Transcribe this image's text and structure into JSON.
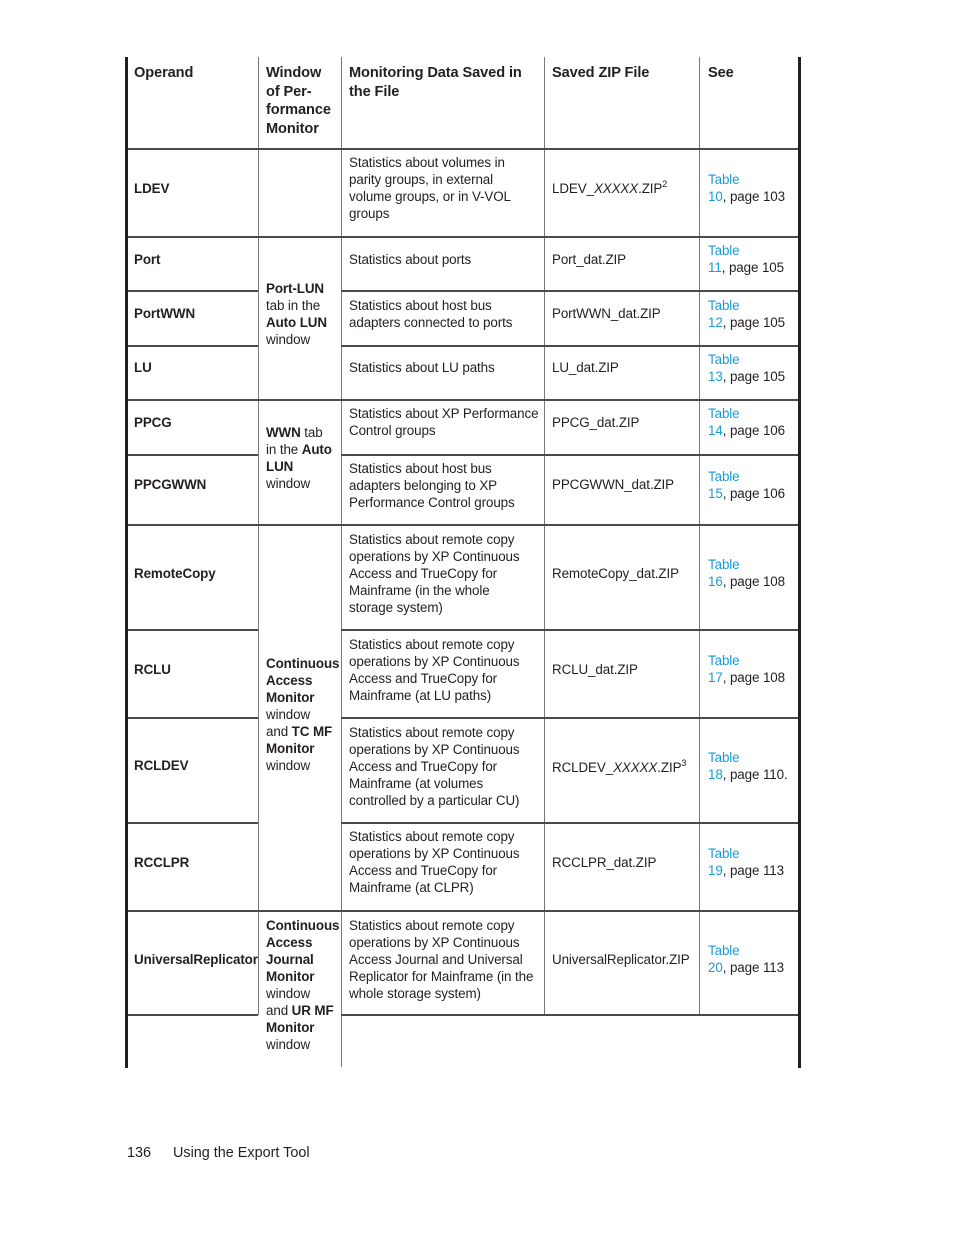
{
  "table": {
    "headers": {
      "operand": "Operand",
      "window": "Window of Per-formance Monitor",
      "window_lines": [
        "Window",
        "of Per-",
        "formance",
        "Monitor"
      ],
      "monitoring": "Monitoring Data Saved in the File",
      "monitoring_lines": [
        "Monitoring Data Saved in",
        "the File"
      ],
      "zip": "Saved ZIP File",
      "see": "See"
    },
    "rows": [
      {
        "operand": "LDEV",
        "monitoring_lines": [
          "Statistics about volumes in",
          "parity groups, in external",
          "volume groups, or in V-VOL",
          "groups"
        ],
        "zip_prefix": "LDEV_",
        "zip_var": "XXXXX",
        "zip_suffix": ".ZIP",
        "zip_note": "2",
        "see_link": "Table",
        "see_num": "10",
        "see_rest": ", page 103"
      },
      {
        "operand": "Port",
        "monitoring_lines": [
          "Statistics about ports"
        ],
        "zip": "Port_dat.ZIP",
        "see_link": "Table",
        "see_num": "11",
        "see_rest": ", page 105"
      },
      {
        "operand": "PortWWN",
        "monitoring_lines": [
          "Statistics about host bus",
          "adapters connected to ports"
        ],
        "zip": "PortWWN_dat.ZIP",
        "see_link": "Table",
        "see_num": "12",
        "see_rest": ", page 105"
      },
      {
        "operand": "LU",
        "monitoring_lines": [
          "Statistics about LU paths"
        ],
        "zip": "LU_dat.ZIP",
        "see_link": "Table",
        "see_num": "13",
        "see_rest": ", page 105"
      },
      {
        "operand": "PPCG",
        "monitoring_lines": [
          "Statistics about XP Performance",
          "Control groups"
        ],
        "zip": "PPCG_dat.ZIP",
        "see_link": "Table",
        "see_num": "14",
        "see_rest": ", page 106"
      },
      {
        "operand": "PPCGWWN",
        "monitoring_lines": [
          "Statistics about host bus",
          "adapters belonging to XP",
          "Performance Control groups"
        ],
        "zip": "PPCGWWN_dat.ZIP",
        "see_link": "Table",
        "see_num": "15",
        "see_rest": ", page 106"
      },
      {
        "operand": "RemoteCopy",
        "monitoring_lines": [
          "Statistics about remote copy",
          "operations by XP Continuous",
          "Access and TrueCopy for",
          "Mainframe (in the whole",
          "storage system)"
        ],
        "zip": "RemoteCopy_dat.ZIP",
        "see_link": "Table",
        "see_num": "16",
        "see_rest": ", page 108"
      },
      {
        "operand": "RCLU",
        "monitoring_lines": [
          "Statistics about remote copy",
          "operations by XP Continuous",
          "Access and TrueCopy for",
          "Mainframe (at LU paths)"
        ],
        "zip": "RCLU_dat.ZIP",
        "see_link": "Table",
        "see_num": "17",
        "see_rest": ", page 108"
      },
      {
        "operand": "RCLDEV",
        "monitoring_lines": [
          "Statistics about remote copy",
          "operations by XP Continuous",
          "Access and TrueCopy for",
          "Mainframe (at volumes",
          "controlled by a particular CU)"
        ],
        "zip_prefix": "RCLDEV_",
        "zip_var": "XXXXX",
        "zip_suffix": ".ZIP",
        "zip_note": "3",
        "see_link": "Table",
        "see_num": "18",
        "see_rest": ", page 110."
      },
      {
        "operand": "RCCLPR",
        "monitoring_lines": [
          "Statistics about remote copy",
          "operations by XP Continuous",
          "Access and TrueCopy for",
          "Mainframe (at CLPR)"
        ],
        "zip": "RCCLPR_dat.ZIP",
        "see_link": "Table",
        "see_num": "19",
        "see_rest": ", page 113"
      },
      {
        "operand": "UniversalReplicator",
        "monitoring_lines": [
          "Statistics about remote copy",
          "operations by XP Continuous",
          "Access Journal and Universal",
          "Replicator for Mainframe (in the",
          "whole storage system)"
        ],
        "zip": "UniversalReplicator.ZIP",
        "see_link": "Table",
        "see_num": "20",
        "see_rest": ", page 113"
      }
    ],
    "window_groups": {
      "portlun": {
        "b1": "Port-LUN",
        "t1": "tab in the",
        "b2": "Auto LUN",
        "t2": "window"
      },
      "wwn": {
        "b1": "WWN",
        "t1": " tab",
        "t2": "in the ",
        "b2": "Auto",
        "b3": "LUN",
        "t3": "window"
      },
      "ca": {
        "b1": "Continuous",
        "b2": "Access",
        "b3": "Monitor",
        "t1": "window",
        "t2": "and ",
        "b4": "TC MF",
        "b5": "Monitor",
        "t3": "window"
      },
      "caj": {
        "b1": "Continuous",
        "b2": "Access",
        "b3": "Journal",
        "b4": "Monitor",
        "t1": "window",
        "t2": "and ",
        "b5": "UR MF",
        "b6": "Monitor",
        "t3": "window"
      }
    }
  },
  "footer": {
    "page_number": "136",
    "section": "Using the Export Tool"
  },
  "colors": {
    "link": "#1a9bd7",
    "text": "#231f20"
  }
}
